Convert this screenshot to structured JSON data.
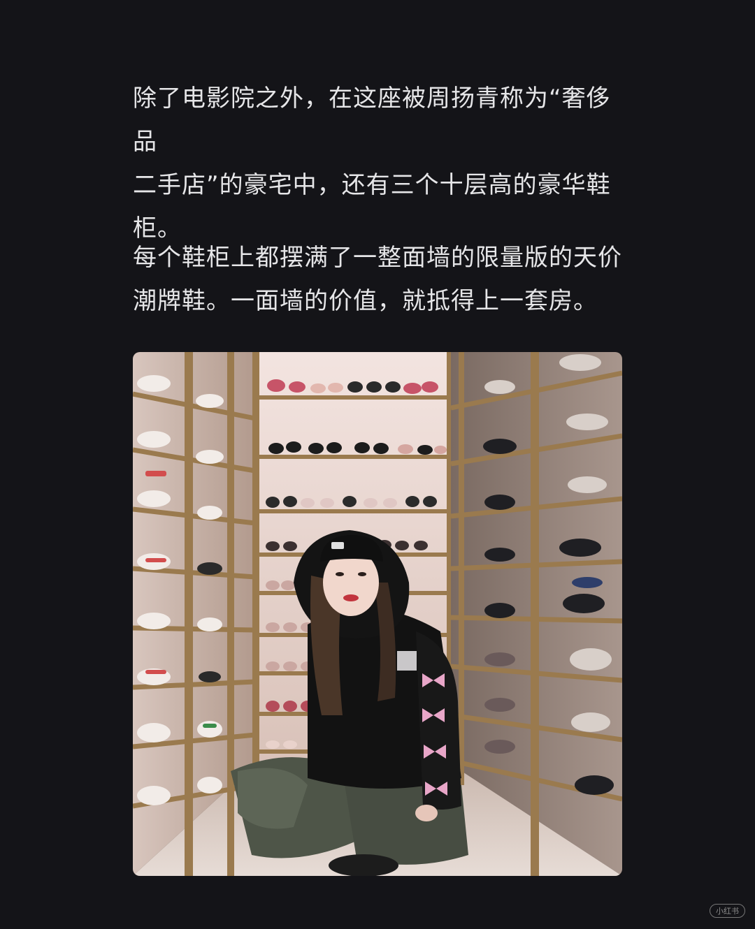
{
  "article": {
    "paragraph1_lines": [
      "除了电影院之外，在这座被周扬青称为“奢侈品",
      "二手店”的豪宅中，还有三个十层高的豪华鞋",
      "柜。"
    ],
    "paragraph2_lines": [
      "每个鞋柜上都摆满了一整面墙的限量版的天价",
      "潮牌鞋。一面墙的价值，就抵得上一套房。"
    ]
  },
  "photo": {
    "subject": "woman in black hoodie with pink bows crouching in shoe closet"
  },
  "watermark": {
    "text": "小红书"
  },
  "colors": {
    "background": "#141418",
    "text": "#e6e6e8",
    "shelf_frame": "#9a7a4e",
    "hoodie": "#111111",
    "bow": "#e8a6c8"
  }
}
